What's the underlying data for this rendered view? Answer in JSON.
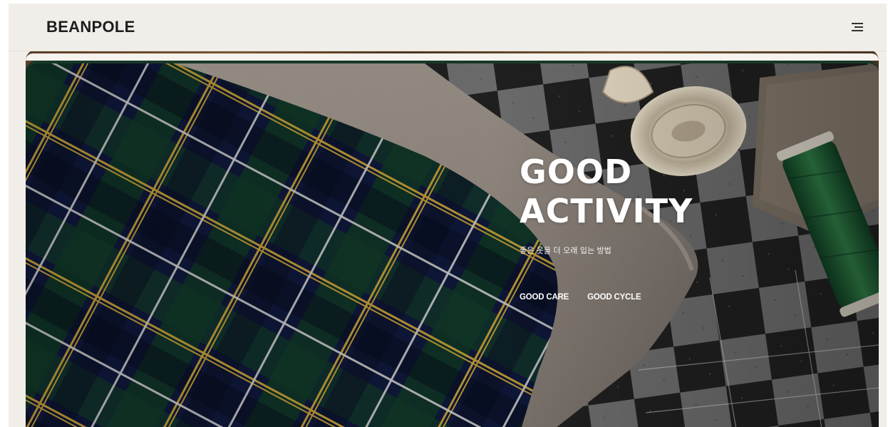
{
  "header": {
    "brand": "BEANPOLE",
    "menu_icon": "hamburger-menu-icon"
  },
  "hero": {
    "title_line1": "GOOD",
    "title_line2": "ACTIVITY",
    "subtitle": "좋은 옷을 더 오래 입는 방법",
    "links": [
      {
        "label": "GOOD CARE"
      },
      {
        "label": "GOOD CYCLE"
      }
    ]
  },
  "colors": {
    "page_bg": "#f1eee9",
    "brand_text": "#1d1d1d",
    "hero_text": "#ffffff",
    "hero_border": "#173828"
  }
}
